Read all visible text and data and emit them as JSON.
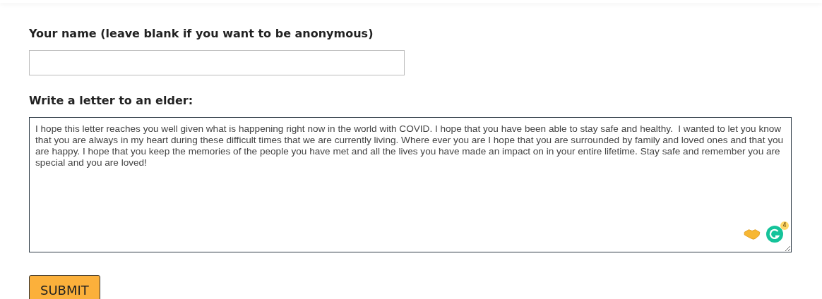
{
  "name_field": {
    "label": "Your name (leave blank if you want to be anonymous)"
  },
  "letter_field": {
    "label": "Write a letter to an elder:",
    "value": "I hope this letter reaches you well given what is happening right now in the world with COVID. I hope that you have been able to stay safe and healthy.  I wanted to let you know that you are always in my heart during these difficult times that we are currently living. Where ever you are I hope that you are surrounded by family and loved ones and that you are happy. I hope that you keep the memories of the people you have met and all the lives you have made an impact on in your entire lifetime. Stay safe and remember you are special and you are loved!",
    "grammar_badge": "4"
  },
  "submit_button": {
    "label": "SUBMIT"
  }
}
